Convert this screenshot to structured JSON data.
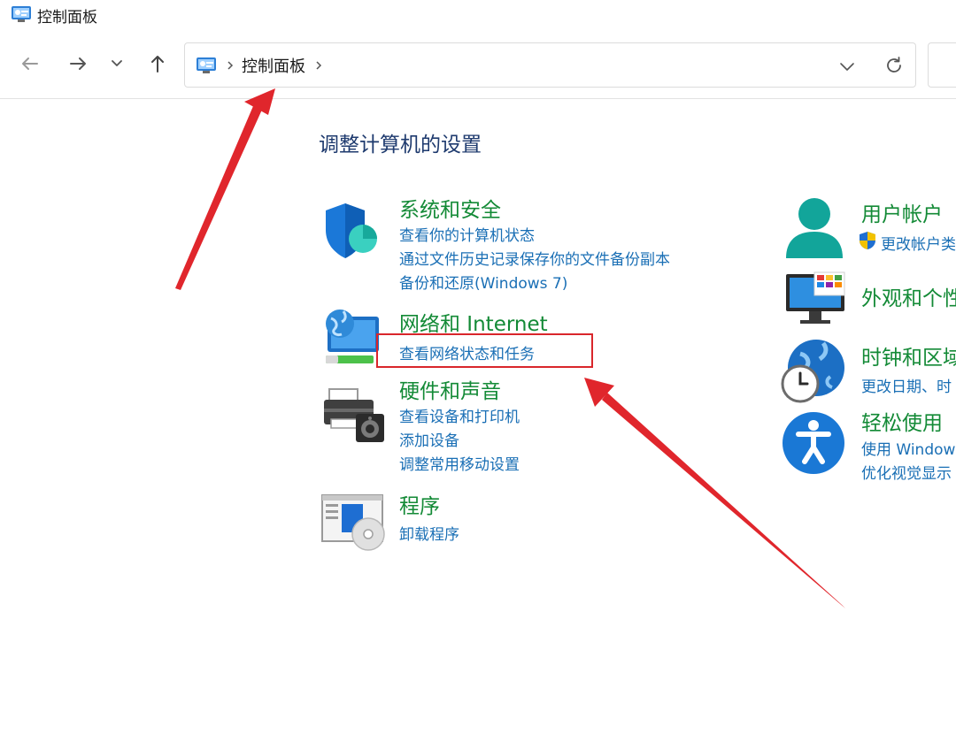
{
  "window": {
    "title": "控制面板"
  },
  "address_bar": {
    "crumb": "控制面板"
  },
  "main": {
    "heading": "调整计算机的设置",
    "left_categories": [
      {
        "title": "系统和安全",
        "links": [
          "查看你的计算机状态",
          "通过文件历史记录保存你的文件备份副本",
          "备份和还原(Windows 7)"
        ]
      },
      {
        "title": "网络和 Internet",
        "links": [
          "查看网络状态和任务"
        ]
      },
      {
        "title": "硬件和声音",
        "links": [
          "查看设备和打印机",
          "添加设备",
          "调整常用移动设置"
        ]
      },
      {
        "title": "程序",
        "links": [
          "卸载程序"
        ]
      }
    ],
    "right_categories": [
      {
        "title": "用户帐户",
        "links": [
          "更改帐户类"
        ]
      },
      {
        "title": "外观和个性",
        "links": []
      },
      {
        "title": "时钟和区域",
        "links": [
          "更改日期、时"
        ]
      },
      {
        "title": "轻松使用",
        "links": [
          "使用 Windows",
          "优化视觉显示"
        ]
      }
    ]
  },
  "colors": {
    "category_title": "#138a36",
    "link": "#1a6fb5",
    "heading": "#1e3a6e",
    "annotation": "#d9262b"
  }
}
